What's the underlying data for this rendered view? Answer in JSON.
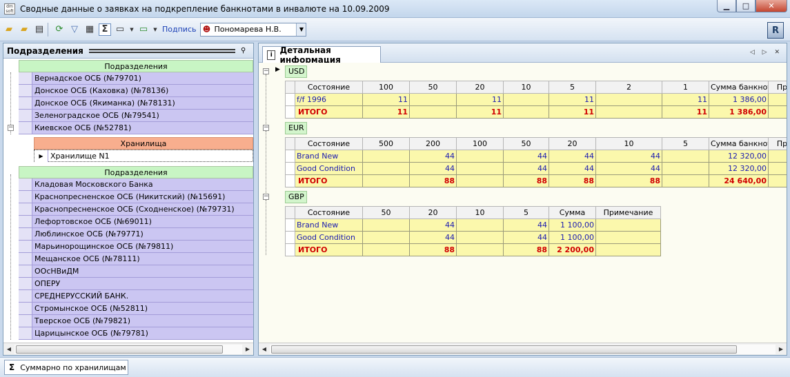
{
  "window": {
    "title": "Сводные данные о заявках на подкрепление банкнотами в инвалюте на 10.09.2009",
    "app_icon_text": "dm soft",
    "minimize": "▁",
    "maximize": "□",
    "close": "✕"
  },
  "toolbar": {
    "sign_label": "Подпись",
    "signer": "Пономарева Н.В.",
    "logo_letter": "R"
  },
  "left_panel": {
    "title": "Подразделения",
    "group_header_1": "Подразделения",
    "items_top": [
      "Вернадское ОСБ (№79701)",
      "Донское ОСБ (Каховка) (№78136)",
      "Донское ОСБ (Якиманка) (№78131)",
      "Зеленоградское ОСБ (№79541)",
      "Киевское ОСБ (№52781)"
    ],
    "storage_header": "Хранилища",
    "storage_item": "Хранилище N1",
    "group_header_2": "Подразделения",
    "items_bottom": [
      "Кладовая Московского Банка",
      "Краснопресненское ОСБ  (Никитский) (№15691)",
      "Краснопресненское ОСБ (Сходненское) (№79731)",
      "Лефортовское ОСБ (№69011)",
      "Люблинское ОСБ (№79771)",
      "Марьинорощинское ОСБ (№79811)",
      "Мещанское ОСБ (№78111)",
      "ООсНВиДМ",
      "ОПЕРУ",
      "СРЕДНЕРУССКИЙ БАНК.",
      "Стромынское ОСБ (№52811)",
      "Тверское ОСБ (№79821)",
      "Царицынское ОСБ (№79781)"
    ]
  },
  "right_panel": {
    "tab_title": "Детальная информация",
    "nav": "◁ ▷ ✕",
    "usd": {
      "label": "USD",
      "headers": [
        "Состояние",
        "100",
        "50",
        "20",
        "10",
        "5",
        "2",
        "1",
        "Сумма банкнот",
        "Пр"
      ],
      "rows": [
        [
          "f/f 1996",
          "11",
          "",
          "11",
          "",
          "11",
          "",
          "11",
          "1 386,00",
          ""
        ]
      ],
      "total": [
        "ИТОГО",
        "11",
        "",
        "11",
        "",
        "11",
        "",
        "11",
        "1 386,00",
        ""
      ]
    },
    "eur": {
      "label": "EUR",
      "headers": [
        "Состояние",
        "500",
        "200",
        "100",
        "50",
        "20",
        "10",
        "5",
        "Сумма банкнот",
        "Пр"
      ],
      "rows": [
        [
          "Brand New",
          "",
          "44",
          "",
          "44",
          "44",
          "44",
          "",
          "12 320,00",
          ""
        ],
        [
          "Good Condition",
          "",
          "44",
          "",
          "44",
          "44",
          "44",
          "",
          "12 320,00",
          ""
        ]
      ],
      "total": [
        "ИТОГО",
        "",
        "88",
        "",
        "88",
        "88",
        "88",
        "",
        "24 640,00",
        ""
      ]
    },
    "gbp": {
      "label": "GBP",
      "headers": [
        "Состояние",
        "50",
        "20",
        "10",
        "5",
        "Сумма",
        "Примечание"
      ],
      "rows": [
        [
          "Brand New",
          "",
          "44",
          "",
          "44",
          "1 100,00",
          ""
        ],
        [
          "Good Condition",
          "",
          "44",
          "",
          "44",
          "1 100,00",
          ""
        ]
      ],
      "total": [
        "ИТОГО",
        "",
        "88",
        "",
        "88",
        "2 200,00",
        ""
      ]
    }
  },
  "statusbar": {
    "sigma": "Σ",
    "label": "Суммарно по хранилищам"
  }
}
